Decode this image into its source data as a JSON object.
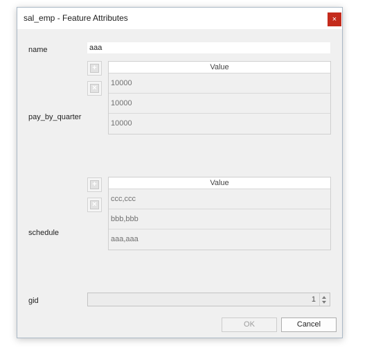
{
  "window": {
    "title": "sal_emp - Feature Attributes",
    "close_glyph": "×",
    "close_color": "#c42b1c"
  },
  "fields": {
    "name": {
      "label": "name",
      "value": "aaa"
    },
    "pay_by_quarter": {
      "label": "pay_by_quarter",
      "column_header": "Value",
      "rows": [
        "10000",
        "10000",
        "10000"
      ]
    },
    "schedule": {
      "label": "schedule",
      "column_header": "Value",
      "rows": [
        "ccc,ccc",
        "bbb,bbb",
        "aaa,aaa"
      ]
    },
    "gid": {
      "label": "gid",
      "value": "1"
    }
  },
  "icons": {
    "add": "plus-icon",
    "remove": "remove-x-icon",
    "add_glyph": "+",
    "remove_glyph": "×"
  },
  "buttons": {
    "ok": "OK",
    "cancel": "Cancel"
  }
}
